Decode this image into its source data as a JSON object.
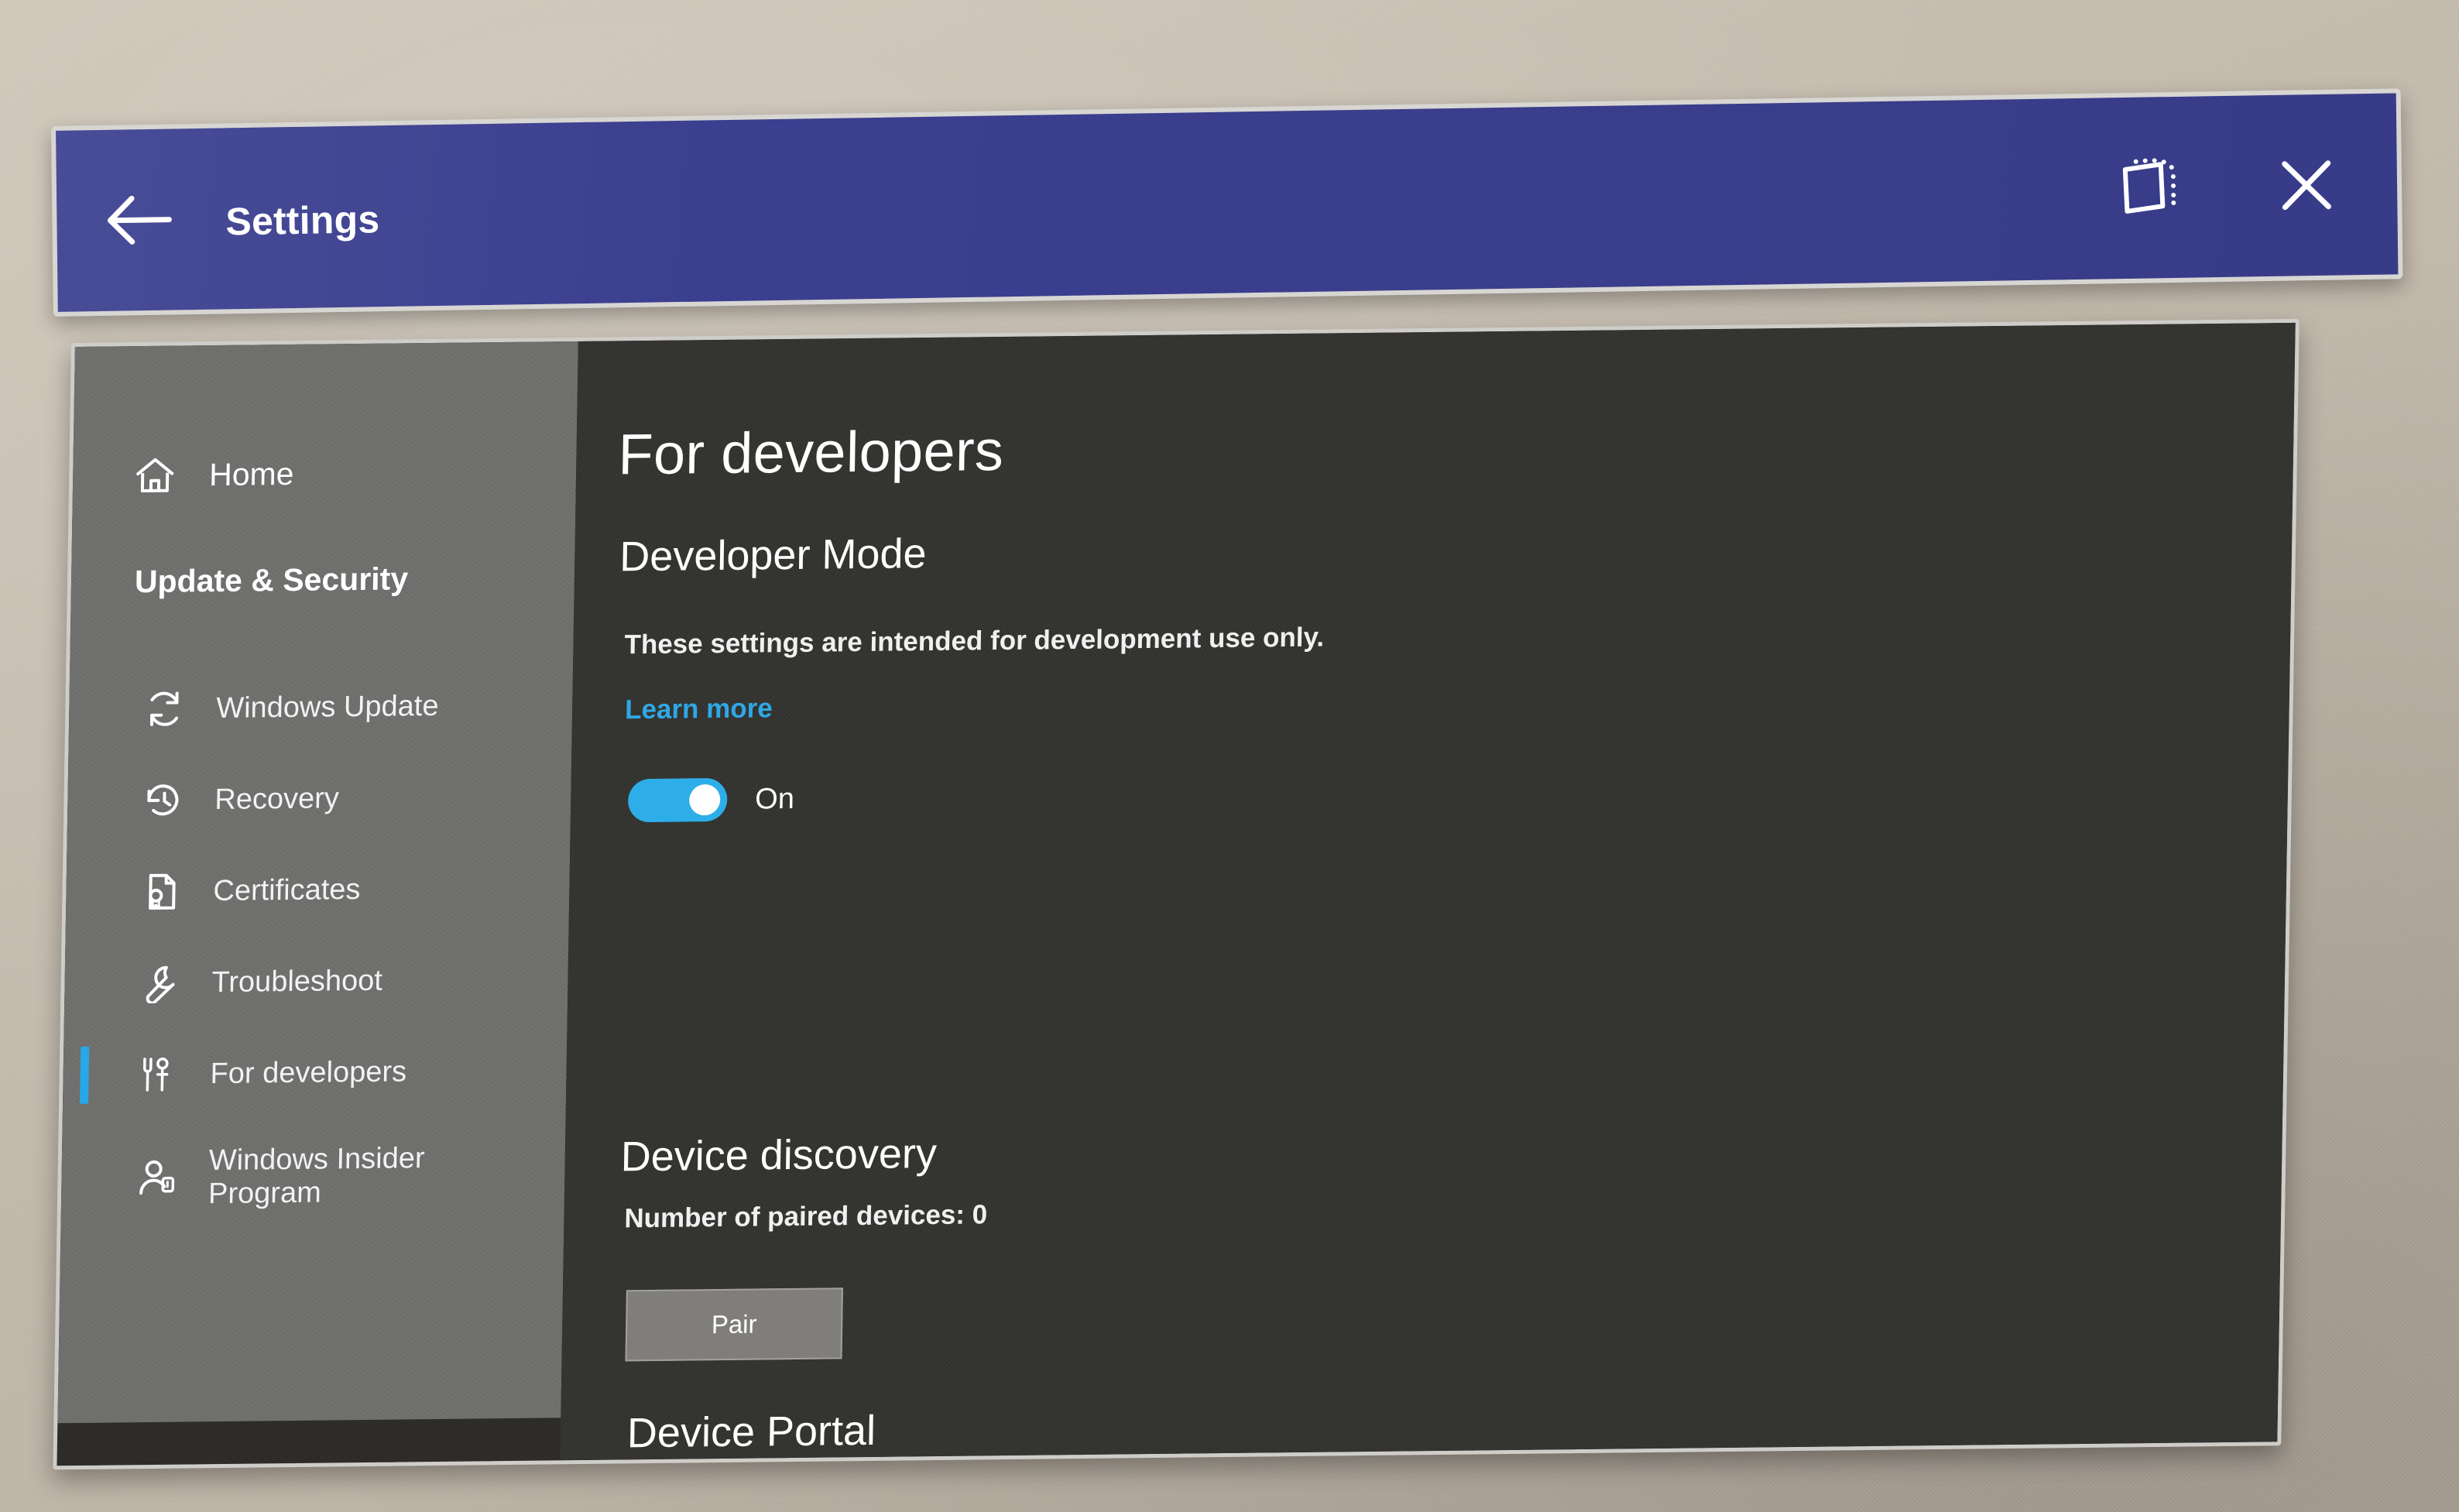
{
  "titlebar": {
    "back_icon": "back-arrow-icon",
    "title": "Settings",
    "follow_icon": "follow-me-window-icon",
    "close_icon": "close-icon"
  },
  "sidebar": {
    "home": {
      "label": "Home",
      "icon": "home-icon"
    },
    "group_title": "Update & Security",
    "items": [
      {
        "label": "Windows Update",
        "icon": "sync-refresh-icon",
        "selected": false
      },
      {
        "label": "Recovery",
        "icon": "history-clock-icon",
        "selected": false
      },
      {
        "label": "Certificates",
        "icon": "certificate-document-icon",
        "selected": false
      },
      {
        "label": "Troubleshoot",
        "icon": "wrench-icon",
        "selected": false
      },
      {
        "label": "For developers",
        "icon": "developer-tools-icon",
        "selected": true
      },
      {
        "label": "Windows Insider Program",
        "icon": "person-badge-icon",
        "selected": false
      }
    ]
  },
  "content": {
    "page_title": "For developers",
    "developer_mode": {
      "heading": "Developer Mode",
      "description": "These settings are intended for development use only.",
      "learn_more": "Learn more",
      "toggle_state": "On",
      "toggle_on": true
    },
    "device_discovery": {
      "heading": "Device discovery",
      "paired_devices_text": "Number of paired devices: 0",
      "pair_button": "Pair"
    },
    "device_portal": {
      "heading": "Device Portal"
    }
  },
  "colors": {
    "titlebar_blue": "#3b3f8f",
    "accent_blue": "#2eaee8",
    "link_blue": "#2ea8e6",
    "sidebar_gray": "#6e6e6c",
    "content_dark": "#333330",
    "wall_beige": "#c4bbae"
  }
}
